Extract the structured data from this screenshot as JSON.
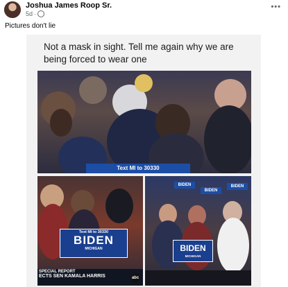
{
  "post": {
    "author": "Joshua James Roop Sr.",
    "time": "5d",
    "privacy_icon": "globe-icon",
    "more_icon": "more-options-icon",
    "more_symbol": "•••",
    "caption": "Pictures don't lie"
  },
  "meme": {
    "headline": "Not a mask in sight.  Tell me again why we are being forced to wear one",
    "photo1": {
      "sign_text": "Text MI to 30330"
    },
    "photo2": {
      "box_small": "Text MI to 30330",
      "box_big": "BIDEN",
      "box_sub": "MICHIGAN",
      "banner_top": "SPECIAL REPORT",
      "banner_bottom": "ECTS SEN KAMALA HARRIS",
      "network": "abc"
    },
    "photo3": {
      "signs": [
        "BIDEN",
        "BIDEN",
        "BIDEN"
      ],
      "box_big": "BIDEN",
      "box_sub": "MICHIGAN"
    }
  }
}
